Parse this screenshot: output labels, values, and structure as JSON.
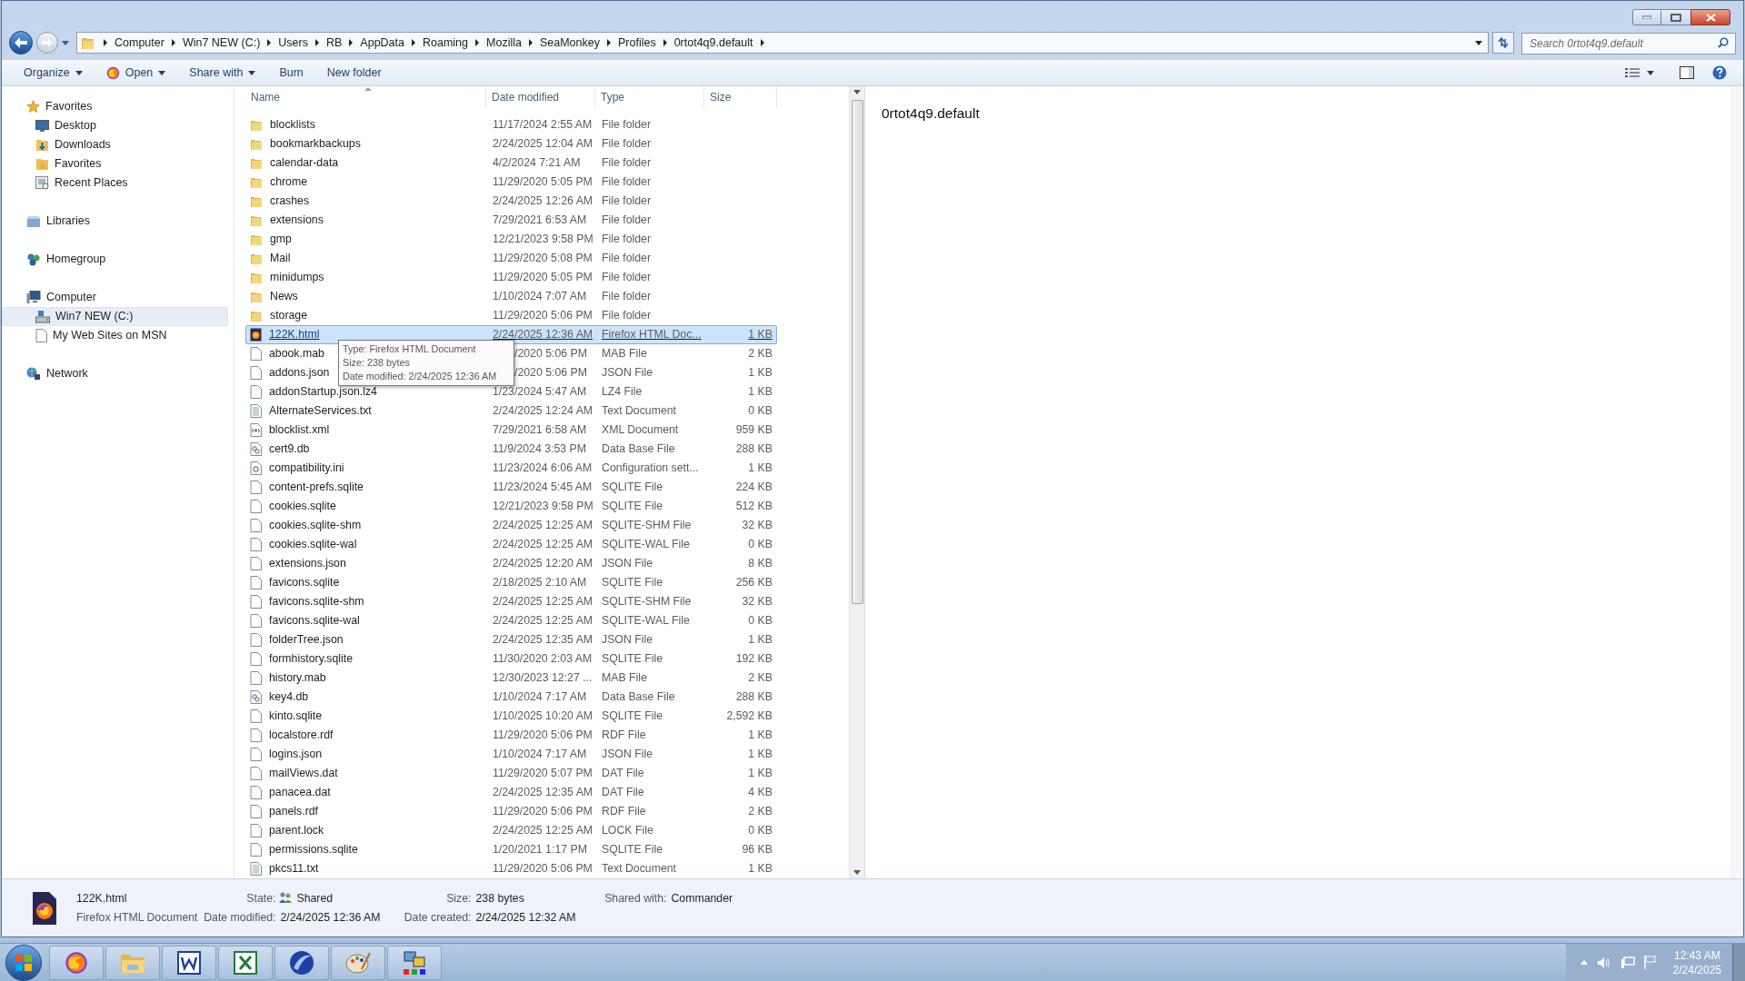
{
  "address_bar": {
    "crumbs": [
      "Computer",
      "Win7 NEW (C:)",
      "Users",
      "RB",
      "AppData",
      "Roaming",
      "Mozilla",
      "SeaMonkey",
      "Profiles",
      "0rtot4q9.default"
    ]
  },
  "search": {
    "placeholder": "Search 0rtot4q9.default"
  },
  "toolbar": [
    {
      "label": "Organize",
      "kind": "menu"
    },
    {
      "label": "Open",
      "kind": "app_menu"
    },
    {
      "label": "Share with",
      "kind": "menu"
    },
    {
      "label": "Burn",
      "kind": "plain"
    },
    {
      "label": "New folder",
      "kind": "plain"
    }
  ],
  "sidebar": {
    "items": [
      {
        "label": "Favorites",
        "kind": "star",
        "selected": false,
        "children": [
          {
            "label": "Desktop",
            "kind": "desktop",
            "selected": false
          },
          {
            "label": "Downloads",
            "kind": "downloads",
            "selected": false
          },
          {
            "label": "Favorites",
            "kind": "favfolder",
            "selected": false
          },
          {
            "label": "Recent Places",
            "kind": "recent",
            "selected": false
          }
        ]
      },
      {
        "label": "Libraries",
        "kind": "libraries",
        "selected": false
      },
      {
        "label": "Homegroup",
        "kind": "homegroup",
        "selected": false
      },
      {
        "label": "Computer",
        "kind": "computer",
        "selected": false,
        "children": [
          {
            "label": "Win7 NEW (C:)",
            "kind": "drive",
            "selected": true
          },
          {
            "label": "My Web Sites on MSN",
            "kind": "file",
            "selected": false
          }
        ]
      },
      {
        "label": "Network",
        "kind": "network",
        "selected": false
      }
    ]
  },
  "table": {
    "columns": [
      "Name",
      "Date modified",
      "Type",
      "Size"
    ],
    "rows": [
      {
        "name": "blocklists",
        "date": "11/17/2024 2:55 AM",
        "type": "File folder",
        "size": "",
        "kind": "folder",
        "selected": false
      },
      {
        "name": "bookmarkbackups",
        "date": "2/24/2025 12:04 AM",
        "type": "File folder",
        "kind": "folder",
        "selected": false
      },
      {
        "name": "calendar-data",
        "date": "4/2/2024 7:21 AM",
        "type": "File folder",
        "kind": "folder",
        "selected": false
      },
      {
        "name": "chrome",
        "date": "11/29/2020 5:05 PM",
        "type": "File folder",
        "kind": "folder",
        "selected": false
      },
      {
        "name": "crashes",
        "date": "2/24/2025 12:26 AM",
        "type": "File folder",
        "kind": "folder",
        "selected": false
      },
      {
        "name": "extensions",
        "date": "7/29/2021 6:53 AM",
        "type": "File folder",
        "kind": "folder",
        "selected": false
      },
      {
        "name": "gmp",
        "date": "12/21/2023 9:58 PM",
        "type": "File folder",
        "kind": "folder",
        "selected": false
      },
      {
        "name": "Mail",
        "date": "11/29/2020 5:08 PM",
        "type": "File folder",
        "kind": "folder",
        "selected": false
      },
      {
        "name": "minidumps",
        "date": "11/29/2020 5:05 PM",
        "type": "File folder",
        "kind": "folder",
        "selected": false
      },
      {
        "name": "News",
        "date": "1/10/2024 7:07 AM",
        "type": "File folder",
        "kind": "folder",
        "selected": false
      },
      {
        "name": "storage",
        "date": "11/29/2020 5:06 PM",
        "type": "File folder",
        "kind": "folder",
        "selected": false
      },
      {
        "name": "122K.html",
        "date": "2/24/2025 12:36 AM",
        "type": "Firefox HTML Doc...",
        "size": "1 KB",
        "kind": "html",
        "selected": true
      },
      {
        "name": "abook.mab",
        "date": "/2020 5:06 PM",
        "type": "MAB File",
        "size": "2 KB",
        "kind": "file",
        "selected": false
      },
      {
        "name": "addons.json",
        "date": "/2020 5:06 PM",
        "type": "JSON File",
        "size": "1 KB",
        "kind": "file",
        "selected": false
      },
      {
        "name": "addonStartup.json.lz4",
        "date": "1/23/2024 5:47 AM",
        "type": "LZ4 File",
        "size": "1 KB",
        "kind": "file",
        "selected": false
      },
      {
        "name": "AlternateServices.txt",
        "date": "2/24/2025 12:24 AM",
        "type": "Text Document",
        "size": "0 KB",
        "kind": "text",
        "selected": false
      },
      {
        "name": "blocklist.xml",
        "date": "7/29/2021 6:58 AM",
        "type": "XML Document",
        "size": "959 KB",
        "kind": "xml",
        "selected": false
      },
      {
        "name": "cert9.db",
        "date": "11/9/2024 3:53 PM",
        "type": "Data Base File",
        "size": "288 KB",
        "kind": "database",
        "selected": false
      },
      {
        "name": "compatibility.ini",
        "date": "11/23/2024 6:06 AM",
        "type": "Configuration sett...",
        "size": "1 KB",
        "kind": "config",
        "selected": false
      },
      {
        "name": "content-prefs.sqlite",
        "date": "11/23/2024 5:45 AM",
        "type": "SQLITE File",
        "size": "224 KB",
        "kind": "file",
        "selected": false
      },
      {
        "name": "cookies.sqlite",
        "date": "12/21/2023 9:58 PM",
        "type": "SQLITE File",
        "size": "512 KB",
        "kind": "file",
        "selected": false
      },
      {
        "name": "cookies.sqlite-shm",
        "date": "2/24/2025 12:25 AM",
        "type": "SQLITE-SHM File",
        "size": "32 KB",
        "kind": "file",
        "selected": false
      },
      {
        "name": "cookies.sqlite-wal",
        "date": "2/24/2025 12:25 AM",
        "type": "SQLITE-WAL File",
        "size": "0 KB",
        "kind": "file",
        "selected": false
      },
      {
        "name": "extensions.json",
        "date": "2/24/2025 12:20 AM",
        "type": "JSON File",
        "size": "8 KB",
        "kind": "file",
        "selected": false
      },
      {
        "name": "favicons.sqlite",
        "date": "2/18/2025 2:10 AM",
        "type": "SQLITE File",
        "size": "256 KB",
        "kind": "file",
        "selected": false
      },
      {
        "name": "favicons.sqlite-shm",
        "date": "2/24/2025 12:25 AM",
        "type": "SQLITE-SHM File",
        "size": "32 KB",
        "kind": "file",
        "selected": false
      },
      {
        "name": "favicons.sqlite-wal",
        "date": "2/24/2025 12:25 AM",
        "type": "SQLITE-WAL File",
        "size": "0 KB",
        "kind": "file",
        "selected": false
      },
      {
        "name": "folderTree.json",
        "date": "2/24/2025 12:35 AM",
        "type": "JSON File",
        "size": "1 KB",
        "kind": "file",
        "selected": false
      },
      {
        "name": "formhistory.sqlite",
        "date": "11/30/2020 2:03 AM",
        "type": "SQLITE File",
        "size": "192 KB",
        "kind": "file",
        "selected": false
      },
      {
        "name": "history.mab",
        "date": "12/30/2023 12:27 ...",
        "type": "MAB File",
        "size": "2 KB",
        "kind": "file",
        "selected": false
      },
      {
        "name": "key4.db",
        "date": "1/10/2024 7:17 AM",
        "type": "Data Base File",
        "size": "288 KB",
        "kind": "database",
        "selected": false
      },
      {
        "name": "kinto.sqlite",
        "date": "1/10/2025 10:20 AM",
        "type": "SQLITE File",
        "size": "2,592 KB",
        "kind": "file",
        "selected": false
      },
      {
        "name": "localstore.rdf",
        "date": "11/29/2020 5:06 PM",
        "type": "RDF File",
        "size": "1 KB",
        "kind": "file",
        "selected": false
      },
      {
        "name": "logins.json",
        "date": "1/10/2024 7:17 AM",
        "type": "JSON File",
        "size": "1 KB",
        "kind": "file",
        "selected": false
      },
      {
        "name": "mailViews.dat",
        "date": "11/29/2020 5:07 PM",
        "type": "DAT File",
        "size": "1 KB",
        "kind": "file",
        "selected": false
      },
      {
        "name": "panacea.dat",
        "date": "2/24/2025 12:35 AM",
        "type": "DAT File",
        "size": "4 KB",
        "kind": "file",
        "selected": false
      },
      {
        "name": "panels.rdf",
        "date": "11/29/2020 5:06 PM",
        "type": "RDF File",
        "size": "2 KB",
        "kind": "file",
        "selected": false
      },
      {
        "name": "parent.lock",
        "date": "2/24/2025 12:25 AM",
        "type": "LOCK File",
        "size": "0 KB",
        "kind": "file",
        "selected": false
      },
      {
        "name": "permissions.sqlite",
        "date": "1/20/2021 1:17 PM",
        "type": "SQLITE File",
        "size": "96 KB",
        "kind": "file",
        "selected": false
      },
      {
        "name": "pkcs11.txt",
        "date": "11/29/2020 5:06 PM",
        "type": "Text Document",
        "size": "1 KB",
        "kind": "text",
        "selected": false
      }
    ]
  },
  "tooltip": {
    "lines": [
      "Type: Firefox HTML Document",
      "Size: 238 bytes",
      "Date modified: 2/24/2025 12:36 AM"
    ]
  },
  "preview": {
    "title": "0rtot4q9.default"
  },
  "details": {
    "name": "122K.html",
    "type": "Firefox HTML Document",
    "fields": [
      {
        "label": "State:",
        "value": "Shared",
        "kind": "shared"
      },
      {
        "label": "Date modified:",
        "value": "2/24/2025 12:36 AM",
        "kind": "plain"
      },
      {
        "label": "Size:",
        "value": "238 bytes",
        "kind": "plain"
      },
      {
        "label": "Date created:",
        "value": "2/24/2025 12:32 AM",
        "kind": "plain"
      },
      {
        "label": "Shared with:",
        "value": "Commander",
        "kind": "plain"
      }
    ]
  },
  "clock": {
    "time": "12:43 AM",
    "date": "2/24/2025"
  }
}
